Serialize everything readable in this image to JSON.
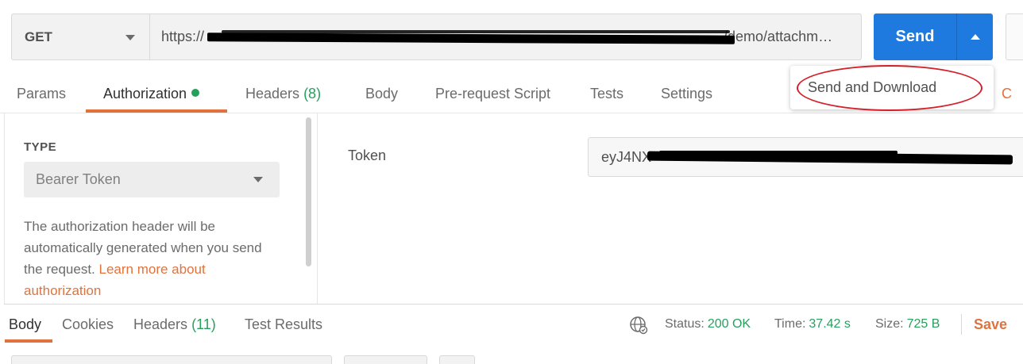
{
  "request": {
    "method": "GET",
    "url_visible_prefix": "https://",
    "url_visible_suffix": "/demo/attachm…",
    "send_label": "Send"
  },
  "send_menu": {
    "items": [
      "Send and Download"
    ]
  },
  "request_tabs": {
    "params": "Params",
    "authorization": "Authorization",
    "headers": "Headers",
    "headers_count": "(8)",
    "body": "Body",
    "prerequest": "Pre-request Script",
    "tests": "Tests",
    "settings": "Settings",
    "cookies_partial": "C"
  },
  "auth": {
    "type_label": "TYPE",
    "type_value": "Bearer Token",
    "description": "The authorization header will be automatically generated when you send the request.",
    "learn_more": "Learn more about authorization",
    "token_label": "Token",
    "token_visible_prefix": "eyJ4NX"
  },
  "response_tabs": {
    "body": "Body",
    "cookies": "Cookies",
    "headers": "Headers",
    "headers_count": "(11)",
    "test_results": "Test Results"
  },
  "response_status": {
    "status_label": "Status:",
    "status_value": "200 OK",
    "time_label": "Time:",
    "time_value": "37.42 s",
    "size_label": "Size:",
    "size_value": "725 B",
    "save_label": "Save"
  },
  "colors": {
    "accent_blue": "#1f7ae0",
    "accent_orange": "#e0733d",
    "success_green": "#26a05d",
    "annotation_red": "#d51f2a"
  },
  "icons": {
    "method_dropdown": "chevron-down-icon",
    "send_options": "chevron-up-icon",
    "auth_status": "dot-icon",
    "network": "globe-icon"
  }
}
